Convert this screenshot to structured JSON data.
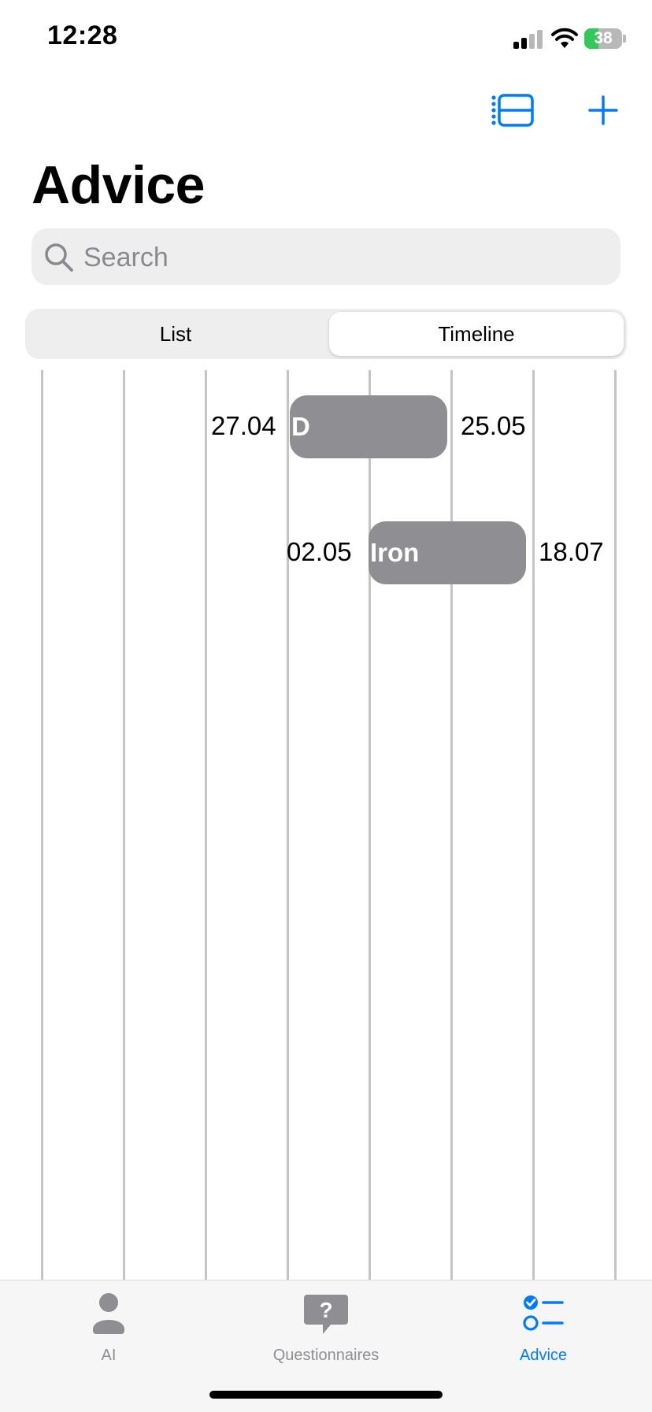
{
  "status_bar": {
    "time": "12:28",
    "battery": "38",
    "battery_level": 0.38
  },
  "nav": {
    "sidebar_icon": "sidebar-list-icon",
    "add_icon": "plus-icon"
  },
  "page": {
    "title": "Advice"
  },
  "search": {
    "placeholder": "Search",
    "value": ""
  },
  "segmented": {
    "options": [
      "List",
      "Timeline"
    ],
    "selected": "Timeline"
  },
  "timeline": {
    "items": [
      {
        "label": "D",
        "start": "27.04",
        "end": "25.05"
      },
      {
        "label": "Iron",
        "start": "02.05",
        "end": "18.07"
      }
    ]
  },
  "tabbar": {
    "tabs": [
      {
        "label": "AI",
        "icon": "person-icon"
      },
      {
        "label": "Questionnaires",
        "icon": "question-bubble-icon"
      },
      {
        "label": "Advice",
        "icon": "checklist-icon"
      }
    ],
    "active": "Advice"
  },
  "colors": {
    "accent": "#007aff",
    "bar": "#8e8e93",
    "battery": "#34c759",
    "grid": "#c4c4c4"
  }
}
